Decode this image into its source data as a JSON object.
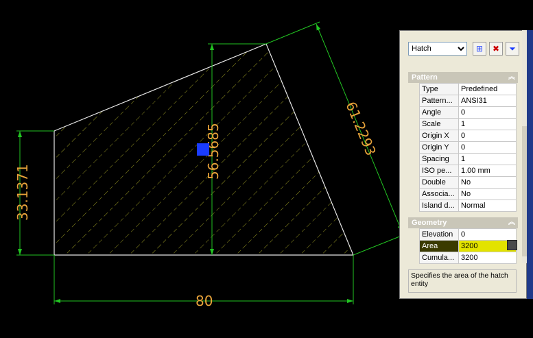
{
  "drawing": {
    "dim_bottom": "80",
    "dim_left": "33.1371",
    "dim_center": "56.5685",
    "dim_slant": "61.2293"
  },
  "palette": {
    "object_type": "Hatch",
    "pattern_section": "Pattern",
    "pattern_rows": [
      {
        "key": "Type",
        "value": "Predefined"
      },
      {
        "key": "Pattern...",
        "value": "ANSI31"
      },
      {
        "key": "Angle",
        "value": "0"
      },
      {
        "key": "Scale",
        "value": "1"
      },
      {
        "key": "Origin X",
        "value": "0"
      },
      {
        "key": "Origin Y",
        "value": "0"
      },
      {
        "key": "Spacing",
        "value": "1"
      },
      {
        "key": "ISO pe...",
        "value": "1.00 mm"
      },
      {
        "key": "Double",
        "value": "No"
      },
      {
        "key": "Associa...",
        "value": "No"
      },
      {
        "key": "Island d...",
        "value": "Normal"
      }
    ],
    "geometry_section": "Geometry",
    "geometry_rows": [
      {
        "key": "Elevation",
        "value": "0"
      },
      {
        "key": "Area",
        "value": "3200"
      },
      {
        "key": "Cumula...",
        "value": "3200"
      }
    ],
    "description": "Specifies the area of the hatch entity"
  },
  "colors": {
    "background": "#000000",
    "dimension": "#22c422",
    "dim_text": "#e8a33a",
    "hatch": "#8f8f20",
    "grip": "#1a3cff",
    "highlight": "#e3e300"
  }
}
